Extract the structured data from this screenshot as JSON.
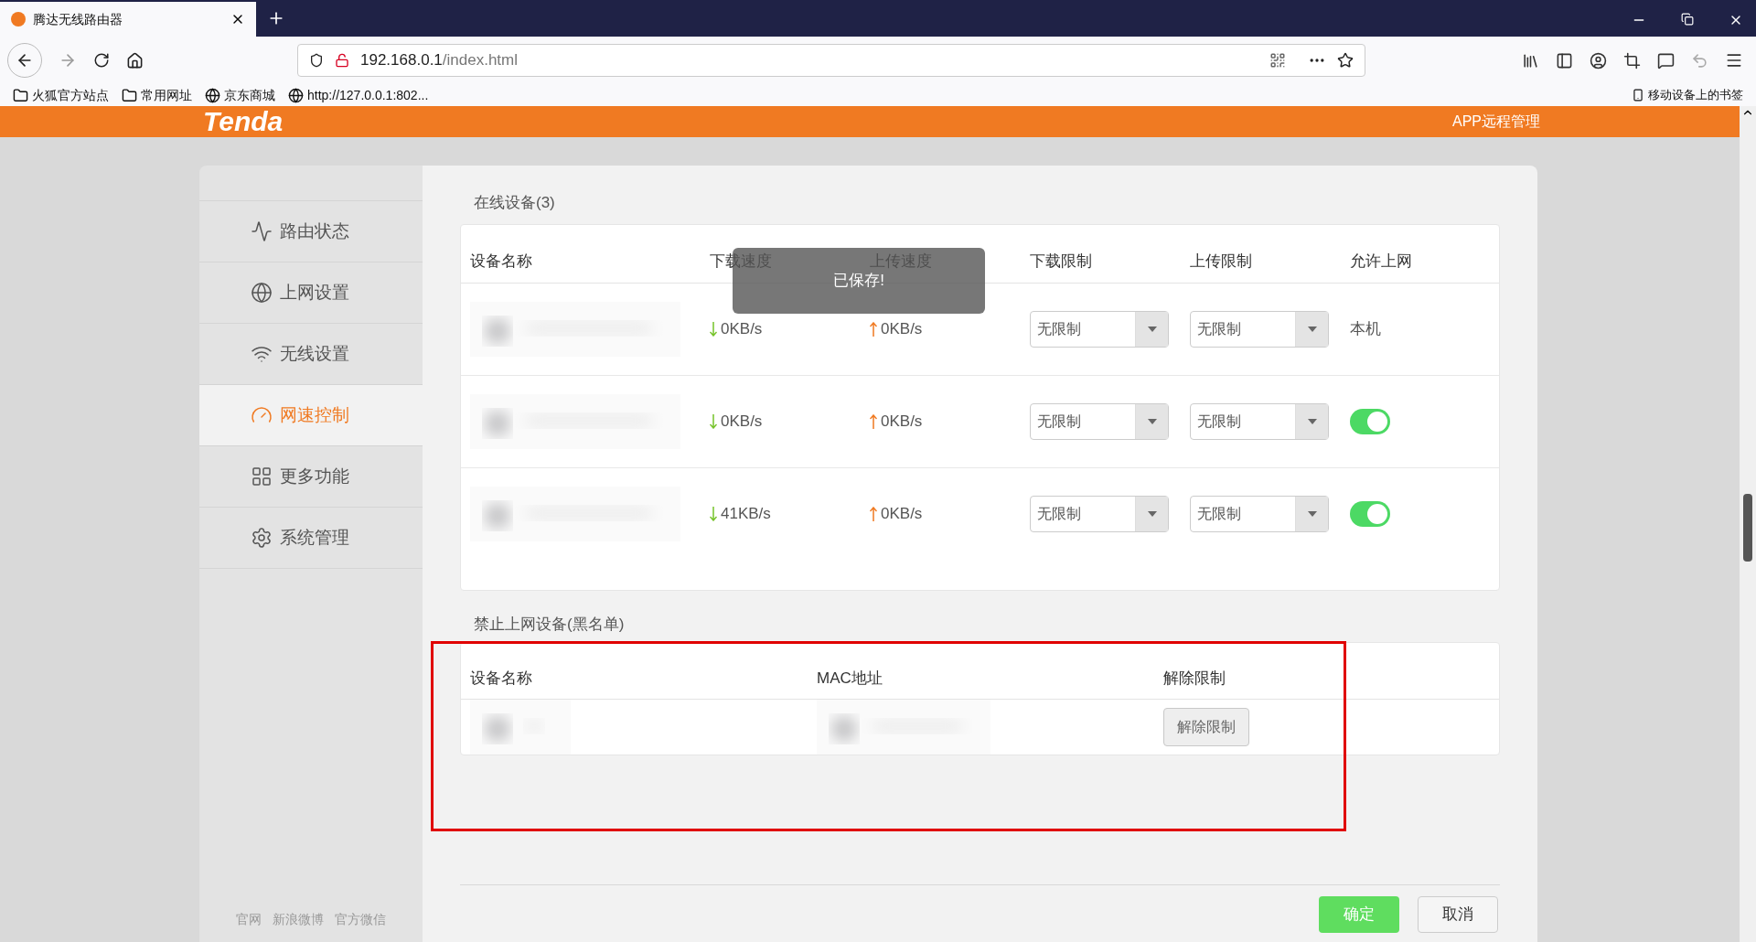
{
  "browser": {
    "tab": {
      "title": "腾达无线路由器"
    },
    "address": {
      "host": "192.168.0.1",
      "path": "/index.html"
    },
    "bookmarks": [
      {
        "kind": "folder",
        "label": "火狐官方站点"
      },
      {
        "kind": "folder",
        "label": "常用网址"
      },
      {
        "kind": "globe",
        "label": "京东商城"
      },
      {
        "kind": "globe",
        "label": "http://127.0.0.1:802..."
      }
    ],
    "mobile_bookmarks": "移动设备上的书签"
  },
  "header": {
    "logo": "Tenda",
    "link": "APP远程管理"
  },
  "sidebar": {
    "items": [
      {
        "label": "路由状态",
        "selected": false
      },
      {
        "label": "上网设置",
        "selected": false
      },
      {
        "label": "无线设置",
        "selected": false
      },
      {
        "label": "网速控制",
        "selected": true
      },
      {
        "label": "更多功能",
        "selected": false
      },
      {
        "label": "系统管理",
        "selected": false
      }
    ],
    "footer_links": [
      "官网",
      "新浪微博",
      "官方微信"
    ]
  },
  "online": {
    "title": "在线设备(3)",
    "columns": [
      "设备名称",
      "下载速度",
      "上传速度",
      "下载限制",
      "上传限制",
      "允许上网"
    ],
    "rows": [
      {
        "download": "0KB/s",
        "upload": "0KB/s",
        "download_limit": "无限制",
        "upload_limit": "无限制",
        "allow": {
          "kind": "text",
          "text": "本机"
        }
      },
      {
        "download": "0KB/s",
        "upload": "0KB/s",
        "download_limit": "无限制",
        "upload_limit": "无限制",
        "allow": {
          "kind": "switch",
          "on": true
        }
      },
      {
        "download": "41KB/s",
        "upload": "0KB/s",
        "download_limit": "无限制",
        "upload_limit": "无限制",
        "allow": {
          "kind": "switch",
          "on": true
        }
      }
    ]
  },
  "toast": "已保存!",
  "blacklist": {
    "title": "禁止上网设备(黑名单)",
    "columns": [
      "设备名称",
      "MAC地址",
      "解除限制"
    ],
    "rows": [
      {
        "action": "解除限制"
      }
    ]
  },
  "buttons": {
    "ok": "确定",
    "cancel": "取消"
  }
}
